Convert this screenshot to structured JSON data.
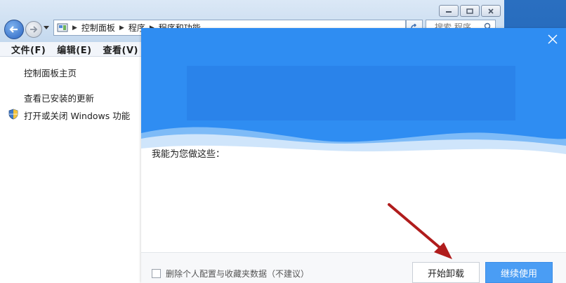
{
  "explorer": {
    "breadcrumbs": [
      "控制面板",
      "程序",
      "程序和功能"
    ],
    "search_placeholder": "搜索 程序",
    "menu": [
      "文件(F)",
      "编辑(E)",
      "查看(V)"
    ],
    "sidebar": {
      "home": "控制面板主页",
      "updates": "查看已安装的更新",
      "features": "打开或关闭 Windows 功能"
    }
  },
  "dialog": {
    "prompt": "我能为您做这些：",
    "checkbox_label": "删除个人配置与收藏夹数据（不建议）",
    "uninstall_button": "开始卸载",
    "continue_button": "继续使用"
  },
  "colors": {
    "hero_blue": "#2f8df2",
    "continue_blue": "#4a9df4",
    "annotation_arrow": "#b01c1c"
  },
  "icons": [
    "back-icon",
    "forward-icon",
    "refresh-icon",
    "search-icon",
    "shield-icon",
    "close-icon",
    "control-panel-icon"
  ]
}
